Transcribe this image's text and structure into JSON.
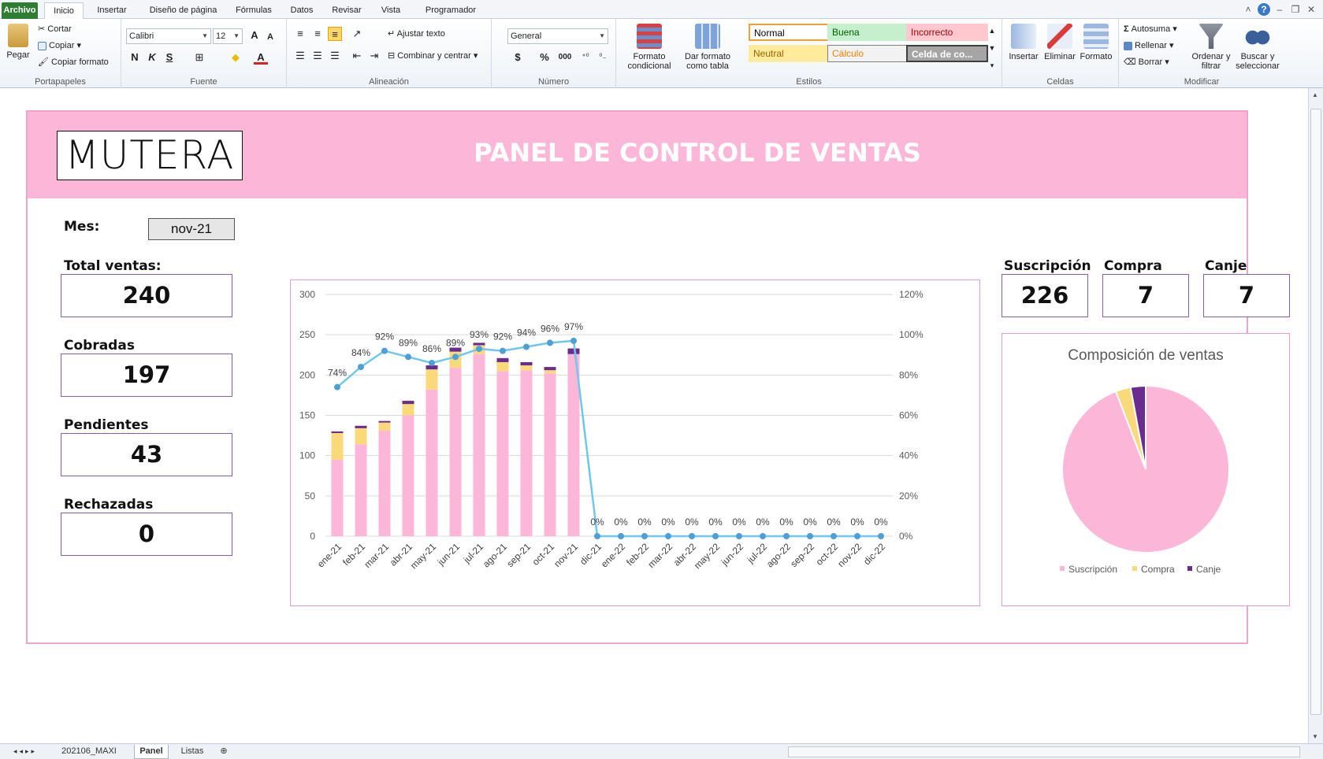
{
  "ribbon": {
    "tabs": [
      "Archivo",
      "Inicio",
      "Insertar",
      "Diseño de página",
      "Fórmulas",
      "Datos",
      "Revisar",
      "Vista",
      "Programador"
    ],
    "clipboard": {
      "paste": "Pegar",
      "cut": "Cortar",
      "copy": "Copiar",
      "format_painter": "Copiar formato",
      "label": "Portapapeles"
    },
    "font": {
      "name": "Calibri",
      "size": "12",
      "bold": "N",
      "italic": "K",
      "underline": "S",
      "label": "Fuente"
    },
    "alignment": {
      "wrap": "Ajustar texto",
      "merge": "Combinar y centrar",
      "label": "Alineación"
    },
    "number": {
      "format": "General",
      "currency": "$",
      "percent": "%",
      "thousands": "000",
      "label": "Número"
    },
    "styles": {
      "conditional": "Formato condicional",
      "as_table": "Dar formato como tabla",
      "cells": [
        {
          "text": "Normal",
          "bg": "#ffffff",
          "fg": "#000000",
          "border": "#f0a030"
        },
        {
          "text": "Buena",
          "bg": "#c6efce",
          "fg": "#006100",
          "border": "#c6efce"
        },
        {
          "text": "Incorrecto",
          "bg": "#ffc7ce",
          "fg": "#9c0006",
          "border": "#ffc7ce"
        },
        {
          "text": "Neutral",
          "bg": "#ffeb9c",
          "fg": "#9c6500",
          "border": "#ffeb9c"
        },
        {
          "text": "Cálculo",
          "bg": "#f2f2f2",
          "fg": "#fa7d00",
          "border": "#7f7f7f"
        },
        {
          "text": "Celda de co...",
          "bg": "#a5a5a5",
          "fg": "#ffffff",
          "border": "#3f3f3f"
        }
      ],
      "label": "Estilos"
    },
    "cells": {
      "insert": "Insertar",
      "delete": "Eliminar",
      "format": "Formato",
      "label": "Celdas"
    },
    "editing": {
      "autosum": "Autosuma",
      "fill": "Rellenar",
      "clear": "Borrar",
      "sort": "Ordenar y filtrar",
      "find": "Buscar y seleccionar",
      "label": "Modificar"
    }
  },
  "dashboard": {
    "logo": "MUTERA",
    "title": "PANEL DE CONTROL DE VENTAS",
    "month_label": "Mes:",
    "month_value": "nov-21",
    "kpis": {
      "total_label": "Total ventas:",
      "total": "240",
      "paid_label": "Cobradas",
      "paid": "197",
      "pending_label": "Pendientes",
      "pending": "43",
      "rejected_label": "Rechazadas",
      "rejected": "0",
      "subscription_label": "Suscripción",
      "subscription": "226",
      "purchase_label": "Compra",
      "purchase": "7",
      "exchange_label": "Canje",
      "exchange": "7"
    }
  },
  "chart_data": [
    {
      "type": "bar",
      "stacked": true,
      "categories": [
        "ene-21",
        "feb-21",
        "mar-21",
        "abr-21",
        "may-21",
        "jun-21",
        "jul-21",
        "ago-21",
        "sep-21",
        "oct-21",
        "nov-21",
        "dic-21",
        "ene-22",
        "feb-22",
        "mar-22",
        "abr-22",
        "may-22",
        "jun-22",
        "jul-22",
        "ago-22",
        "sep-22",
        "oct-22",
        "nov-22",
        "dic-22"
      ],
      "series": [
        {
          "values": [
            95,
            114,
            131,
            150,
            182,
            209,
            226,
            205,
            206,
            202,
            226,
            0,
            0,
            0,
            0,
            0,
            0,
            0,
            0,
            0,
            0,
            0,
            0,
            0
          ]
        },
        {
          "values": [
            33,
            20,
            10,
            14,
            25,
            20,
            11,
            11,
            6,
            4,
            0,
            0,
            0,
            0,
            0,
            0,
            0,
            0,
            0,
            0,
            0,
            0,
            0,
            0
          ]
        },
        {
          "values": [
            2,
            3,
            2,
            4,
            5,
            5,
            3,
            5,
            4,
            4,
            7,
            0,
            0,
            0,
            0,
            0,
            0,
            0,
            0,
            0,
            0,
            0,
            0,
            0
          ]
        }
      ],
      "line_series": {
        "axis": "right",
        "values": [
          0.74,
          0.84,
          0.92,
          0.89,
          0.86,
          0.89,
          0.93,
          0.92,
          0.94,
          0.96,
          0.97,
          0,
          0,
          0,
          0,
          0,
          0,
          0,
          0,
          0,
          0,
          0,
          0,
          0
        ],
        "labels": [
          "74%",
          "84%",
          "92%",
          "89%",
          "86%",
          "89%",
          "93%",
          "92%",
          "94%",
          "96%",
          "97%",
          "0%",
          "0%",
          "0%",
          "0%",
          "0%",
          "0%",
          "0%",
          "0%",
          "0%",
          "0%",
          "0%",
          "0%",
          "0%"
        ]
      },
      "y_ticks": [
        "0",
        "50",
        "100",
        "150",
        "200",
        "250",
        "300"
      ],
      "y2_ticks": [
        "0%",
        "20%",
        "40%",
        "60%",
        "80%",
        "100%",
        "120%"
      ],
      "ylim": [
        0,
        300
      ],
      "y2lim": [
        0,
        1.2
      ],
      "grid": true,
      "colors": {
        "suscripcion": "#fbb6d8",
        "compra": "#fad97a",
        "canje": "#6a2c8e",
        "line": "#6fc7ee",
        "marker": "#4e9fd6"
      }
    },
    {
      "type": "pie",
      "title": "Composición de ventas",
      "labels": [
        "Suscripción",
        "Compra",
        "Canje"
      ],
      "values": [
        226,
        7,
        7
      ],
      "colors": [
        "#fbb6d8",
        "#fad97a",
        "#6a2c8e"
      ],
      "legend": "bottom"
    }
  ],
  "sheets": [
    "202106_MAXI",
    "Panel",
    "Listas"
  ]
}
